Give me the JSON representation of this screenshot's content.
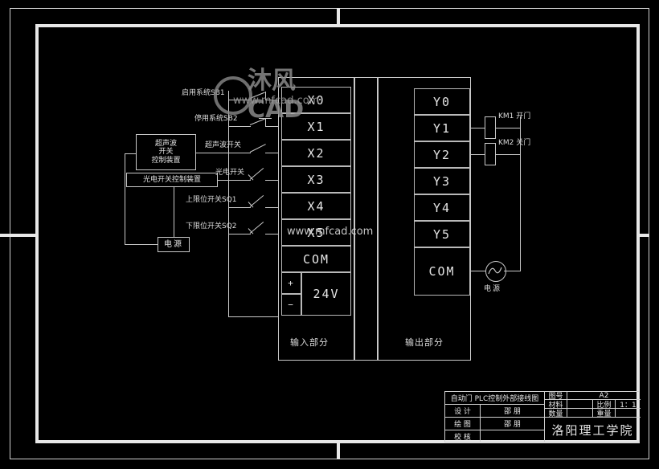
{
  "drawing": {
    "title": "自动门 PLC控制外部接线图",
    "watermark": {
      "logo": "沐风CAD",
      "url": "www.mfcad.com",
      "url_overlay": "www.mfcad.com"
    },
    "devices": {
      "ultrasonic_controller": "超声波\n开关\n控制装置",
      "ultrasonic_controller_lines": [
        "超声波",
        "开关",
        "控制装置"
      ],
      "photoelectric_controller": "光电开关控制装置",
      "power_supply_box": "电源",
      "ac_source_label": "电源"
    },
    "input_switches": [
      {
        "label": "启用系统SB1",
        "terminal": "X0"
      },
      {
        "label": "停用系统SB2",
        "terminal": "X1"
      },
      {
        "label": "超声波开关",
        "terminal": "X2"
      },
      {
        "label": "光电开关",
        "terminal": "X3"
      },
      {
        "label": "上限位开关SQ1",
        "terminal": "X4"
      },
      {
        "label": "下限位开关SQ2",
        "terminal": "X5"
      }
    ],
    "input_terminals": [
      "X0",
      "X1",
      "X2",
      "X3",
      "X4",
      "X5",
      "COM"
    ],
    "input_power": {
      "plus": "+",
      "minus": "−",
      "voltage": "24V"
    },
    "output_terminals": [
      "Y0",
      "Y1",
      "Y2",
      "Y3",
      "Y4",
      "Y5",
      "COM"
    ],
    "output_loads": [
      {
        "name": "KM1",
        "function": "开门",
        "terminal": "Y1"
      },
      {
        "name": "KM2",
        "function": "关门",
        "terminal": "Y2"
      }
    ],
    "section_labels": {
      "input": "输入部分",
      "output": "输出部分"
    }
  },
  "title_block": {
    "drawing_name": "自动门 PLC控制外部接线图",
    "rows": [
      {
        "label": "设 计",
        "value": "邵  朋"
      },
      {
        "label": "绘 图",
        "value": "邵  朋"
      },
      {
        "label": "校 核",
        "value": ""
      }
    ],
    "specs": [
      {
        "label": "图号",
        "value": "A2"
      },
      {
        "label": "材料",
        "value": ""
      },
      {
        "label": "比例",
        "value": "1：1"
      },
      {
        "label": "数量",
        "value": ""
      },
      {
        "label": "重量",
        "value": ""
      }
    ],
    "institution": "洛阳理工学院"
  }
}
